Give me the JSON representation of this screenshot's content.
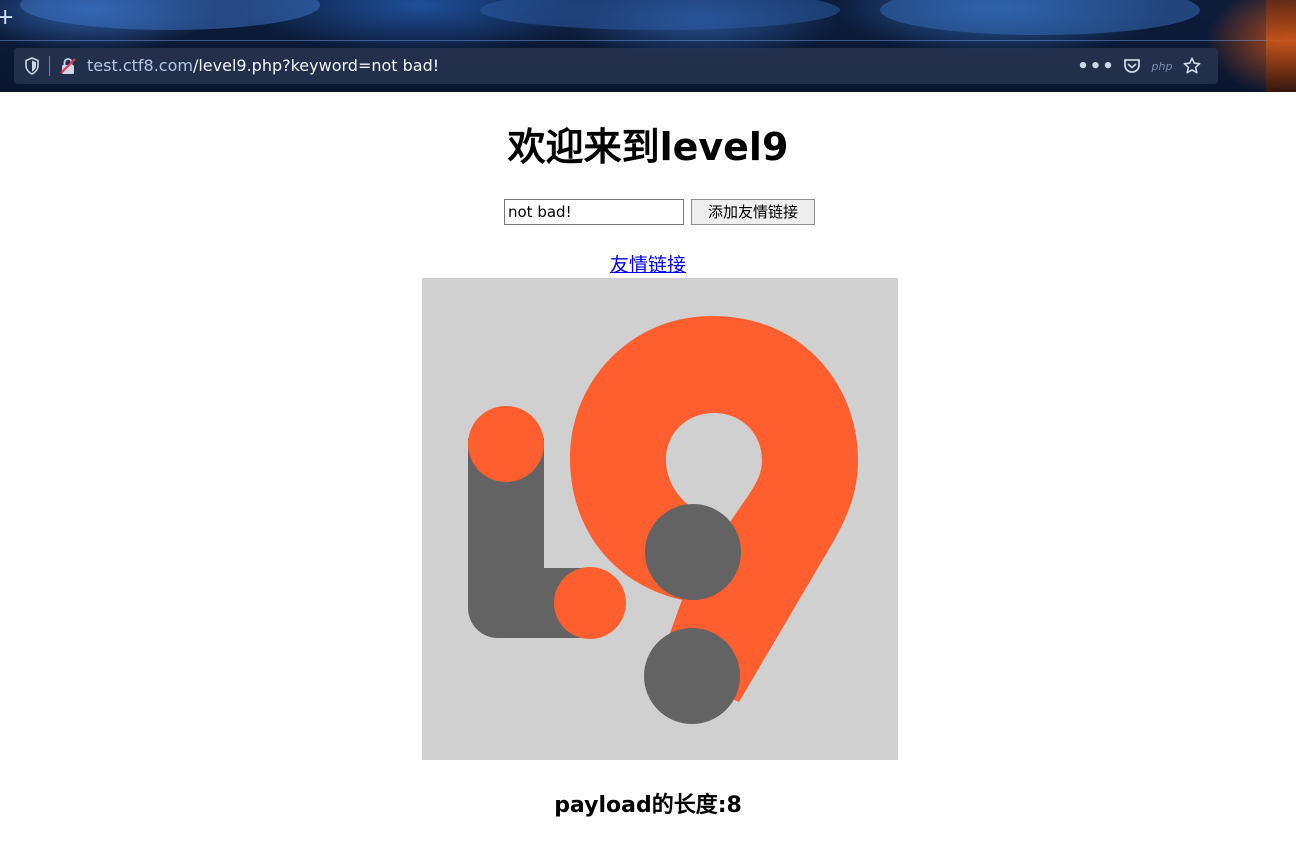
{
  "browser": {
    "new_tab_glyph": "+",
    "url": {
      "scheme": "",
      "host": "test.ctf8.com",
      "path": "/level9.php?keyword=not bad!"
    },
    "actions": {
      "more_glyph": "•••",
      "php_badge": "php"
    },
    "icons": [
      "tracking-shield-icon",
      "insecure-lock-icon",
      "more-icon",
      "pocket-icon",
      "php-icon",
      "bookmark-star-icon"
    ]
  },
  "page": {
    "title": "欢迎来到level9",
    "keyword_input": {
      "value": "not bad!",
      "placeholder": ""
    },
    "submit_button_label": "添加友情链接",
    "friend_link_label": "友情链接",
    "logo": {
      "icon": "level9-logo-icon",
      "background": "#d0d0d0",
      "orange": "#ff5f2e",
      "gray": "#636363"
    },
    "payload_length_text": "payload的长度:8"
  }
}
